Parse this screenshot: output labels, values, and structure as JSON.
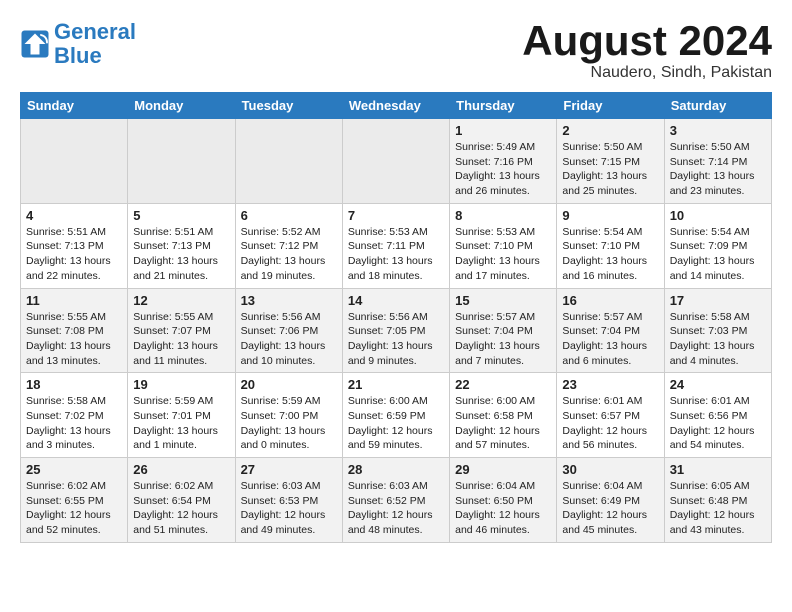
{
  "header": {
    "logo_line1": "General",
    "logo_line2": "Blue",
    "month_title": "August 2024",
    "location": "Naudero, Sindh, Pakistan"
  },
  "weekdays": [
    "Sunday",
    "Monday",
    "Tuesday",
    "Wednesday",
    "Thursday",
    "Friday",
    "Saturday"
  ],
  "weeks": [
    [
      {
        "day": "",
        "info": ""
      },
      {
        "day": "",
        "info": ""
      },
      {
        "day": "",
        "info": ""
      },
      {
        "day": "",
        "info": ""
      },
      {
        "day": "1",
        "info": "Sunrise: 5:49 AM\nSunset: 7:16 PM\nDaylight: 13 hours and 26 minutes."
      },
      {
        "day": "2",
        "info": "Sunrise: 5:50 AM\nSunset: 7:15 PM\nDaylight: 13 hours and 25 minutes."
      },
      {
        "day": "3",
        "info": "Sunrise: 5:50 AM\nSunset: 7:14 PM\nDaylight: 13 hours and 23 minutes."
      }
    ],
    [
      {
        "day": "4",
        "info": "Sunrise: 5:51 AM\nSunset: 7:13 PM\nDaylight: 13 hours and 22 minutes."
      },
      {
        "day": "5",
        "info": "Sunrise: 5:51 AM\nSunset: 7:13 PM\nDaylight: 13 hours and 21 minutes."
      },
      {
        "day": "6",
        "info": "Sunrise: 5:52 AM\nSunset: 7:12 PM\nDaylight: 13 hours and 19 minutes."
      },
      {
        "day": "7",
        "info": "Sunrise: 5:53 AM\nSunset: 7:11 PM\nDaylight: 13 hours and 18 minutes."
      },
      {
        "day": "8",
        "info": "Sunrise: 5:53 AM\nSunset: 7:10 PM\nDaylight: 13 hours and 17 minutes."
      },
      {
        "day": "9",
        "info": "Sunrise: 5:54 AM\nSunset: 7:10 PM\nDaylight: 13 hours and 16 minutes."
      },
      {
        "day": "10",
        "info": "Sunrise: 5:54 AM\nSunset: 7:09 PM\nDaylight: 13 hours and 14 minutes."
      }
    ],
    [
      {
        "day": "11",
        "info": "Sunrise: 5:55 AM\nSunset: 7:08 PM\nDaylight: 13 hours and 13 minutes."
      },
      {
        "day": "12",
        "info": "Sunrise: 5:55 AM\nSunset: 7:07 PM\nDaylight: 13 hours and 11 minutes."
      },
      {
        "day": "13",
        "info": "Sunrise: 5:56 AM\nSunset: 7:06 PM\nDaylight: 13 hours and 10 minutes."
      },
      {
        "day": "14",
        "info": "Sunrise: 5:56 AM\nSunset: 7:05 PM\nDaylight: 13 hours and 9 minutes."
      },
      {
        "day": "15",
        "info": "Sunrise: 5:57 AM\nSunset: 7:04 PM\nDaylight: 13 hours and 7 minutes."
      },
      {
        "day": "16",
        "info": "Sunrise: 5:57 AM\nSunset: 7:04 PM\nDaylight: 13 hours and 6 minutes."
      },
      {
        "day": "17",
        "info": "Sunrise: 5:58 AM\nSunset: 7:03 PM\nDaylight: 13 hours and 4 minutes."
      }
    ],
    [
      {
        "day": "18",
        "info": "Sunrise: 5:58 AM\nSunset: 7:02 PM\nDaylight: 13 hours and 3 minutes."
      },
      {
        "day": "19",
        "info": "Sunrise: 5:59 AM\nSunset: 7:01 PM\nDaylight: 13 hours and 1 minute."
      },
      {
        "day": "20",
        "info": "Sunrise: 5:59 AM\nSunset: 7:00 PM\nDaylight: 13 hours and 0 minutes."
      },
      {
        "day": "21",
        "info": "Sunrise: 6:00 AM\nSunset: 6:59 PM\nDaylight: 12 hours and 59 minutes."
      },
      {
        "day": "22",
        "info": "Sunrise: 6:00 AM\nSunset: 6:58 PM\nDaylight: 12 hours and 57 minutes."
      },
      {
        "day": "23",
        "info": "Sunrise: 6:01 AM\nSunset: 6:57 PM\nDaylight: 12 hours and 56 minutes."
      },
      {
        "day": "24",
        "info": "Sunrise: 6:01 AM\nSunset: 6:56 PM\nDaylight: 12 hours and 54 minutes."
      }
    ],
    [
      {
        "day": "25",
        "info": "Sunrise: 6:02 AM\nSunset: 6:55 PM\nDaylight: 12 hours and 52 minutes."
      },
      {
        "day": "26",
        "info": "Sunrise: 6:02 AM\nSunset: 6:54 PM\nDaylight: 12 hours and 51 minutes."
      },
      {
        "day": "27",
        "info": "Sunrise: 6:03 AM\nSunset: 6:53 PM\nDaylight: 12 hours and 49 minutes."
      },
      {
        "day": "28",
        "info": "Sunrise: 6:03 AM\nSunset: 6:52 PM\nDaylight: 12 hours and 48 minutes."
      },
      {
        "day": "29",
        "info": "Sunrise: 6:04 AM\nSunset: 6:50 PM\nDaylight: 12 hours and 46 minutes."
      },
      {
        "day": "30",
        "info": "Sunrise: 6:04 AM\nSunset: 6:49 PM\nDaylight: 12 hours and 45 minutes."
      },
      {
        "day": "31",
        "info": "Sunrise: 6:05 AM\nSunset: 6:48 PM\nDaylight: 12 hours and 43 minutes."
      }
    ]
  ]
}
